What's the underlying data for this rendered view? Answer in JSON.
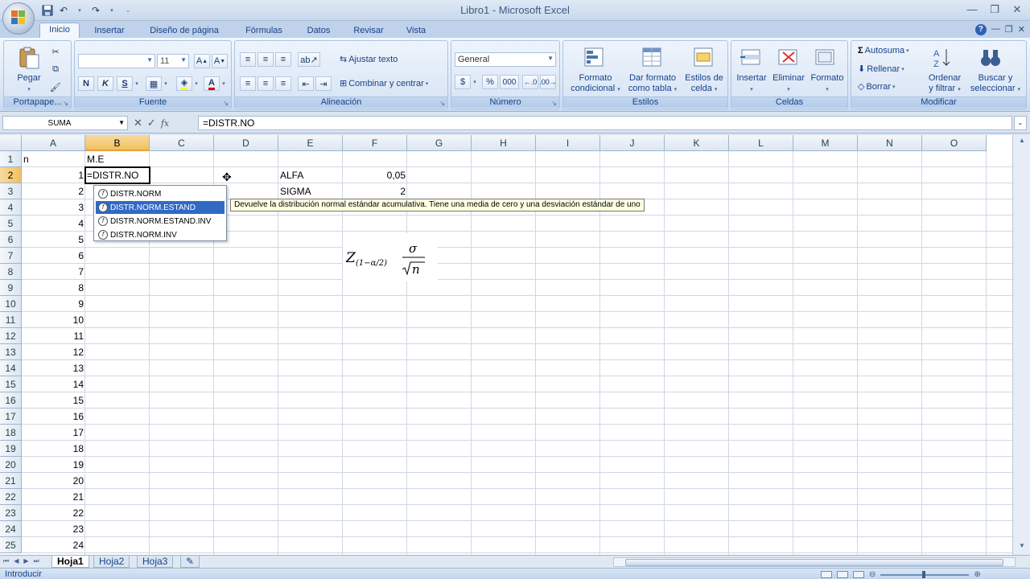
{
  "window": {
    "title": "Libro1 - Microsoft Excel",
    "controls": [
      "—",
      "❐",
      "✕"
    ],
    "inner_controls": [
      "—",
      "❐",
      "✕"
    ]
  },
  "ribbon_tabs": [
    "Inicio",
    "Insertar",
    "Diseño de página",
    "Fórmulas",
    "Datos",
    "Revisar",
    "Vista"
  ],
  "ribbon": {
    "portapapeles": {
      "label": "Portapape...",
      "pegar": "Pegar"
    },
    "fuente": {
      "label": "Fuente",
      "font_name": "",
      "font_size": "11",
      "bold": "N",
      "italic": "K",
      "underline": "S"
    },
    "alineacion": {
      "label": "Alineación",
      "wrap": "Ajustar texto",
      "merge": "Combinar y centrar"
    },
    "numero": {
      "label": "Número",
      "format": "General",
      "currency": "$",
      "percent": "%",
      "thousands": "000"
    },
    "estilos": {
      "label": "Estilos",
      "cond_line1": "Formato",
      "cond_line2": "condicional",
      "table_line1": "Dar formato",
      "table_line2": "como tabla",
      "cell_line1": "Estilos de",
      "cell_line2": "celda"
    },
    "celdas": {
      "label": "Celdas",
      "insert": "Insertar",
      "delete": "Eliminar",
      "format": "Formato"
    },
    "modificar": {
      "label": "Modificar",
      "autosum": "Autosuma",
      "fill": "Rellenar",
      "clear": "Borrar",
      "sort_line1": "Ordenar",
      "sort_line2": "y filtrar",
      "find_line1": "Buscar y",
      "find_line2": "seleccionar"
    }
  },
  "formula_bar": {
    "name_box": "SUMA",
    "formula": "=DISTR.NO"
  },
  "columns": [
    "A",
    "B",
    "C",
    "D",
    "E",
    "F",
    "G",
    "H",
    "I",
    "J",
    "K",
    "L",
    "M",
    "N",
    "O"
  ],
  "selected_column": "B",
  "selected_row": "2",
  "cells": {
    "A1": "n",
    "B1": "M.E",
    "A2": "1",
    "B2": "=DISTR.NO",
    "E2": "ALFA",
    "F2": "0,05",
    "A3": "2",
    "E3": "SIGMA",
    "F3": "2",
    "A4": "3",
    "A5": "4",
    "A6": "5",
    "A7": "6",
    "A8": "7",
    "A9": "8",
    "A10": "9",
    "A11": "10",
    "A12": "11",
    "A13": "12",
    "A14": "13",
    "A15": "14",
    "A16": "15",
    "A17": "16",
    "A18": "17",
    "A19": "18",
    "A20": "19",
    "A21": "20",
    "A22": "21",
    "A23": "22",
    "A24": "23",
    "A25": "24"
  },
  "autocomplete": {
    "items": [
      "DISTR.NORM",
      "DISTR.NORM.ESTAND",
      "DISTR.NORM.ESTAND.INV",
      "DISTR.NORM.INV"
    ],
    "selected_index": 1,
    "tooltip": "Devuelve la distribución normal estándar acumulativa. Tiene una media de cero y una desviación estándar de uno"
  },
  "formula_image": {
    "z": "Z",
    "subscript": "(1−α/2)",
    "numerator": "σ",
    "denominator": "n"
  },
  "sheets": [
    "Hoja1",
    "Hoja2",
    "Hoja3"
  ],
  "active_sheet": "Hoja1",
  "status": "Introducir"
}
